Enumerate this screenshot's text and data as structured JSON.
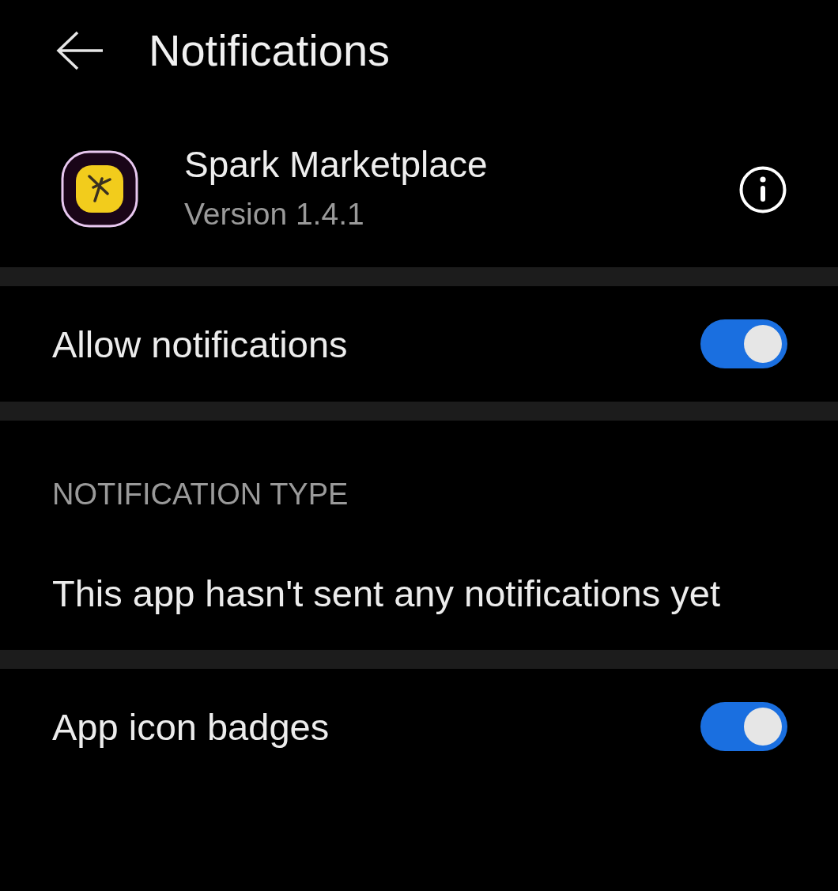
{
  "header": {
    "title": "Notifications"
  },
  "app": {
    "name": "Spark Marketplace",
    "version": "Version 1.4.1"
  },
  "sections": [
    {
      "kind": "toggle",
      "label": "Allow notifications",
      "on": true
    },
    {
      "kind": "group",
      "heading": "NOTIFICATION TYPE",
      "message": "This app hasn't sent any notifications yet"
    },
    {
      "kind": "toggle",
      "label": "App icon badges",
      "on": true
    }
  ]
}
